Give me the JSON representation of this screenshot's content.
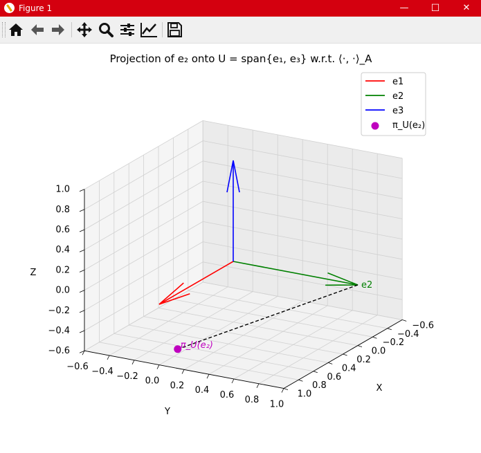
{
  "window": {
    "title": "Figure 1",
    "minimize": "—",
    "maximize": "☐",
    "close": "✕"
  },
  "toolbar": {
    "buttons": [
      "home-icon",
      "back-icon",
      "forward-icon",
      "pan-icon",
      "zoom-icon",
      "configure-subplots-icon",
      "edit-axis-icon",
      "save-icon"
    ]
  },
  "chart_data": {
    "type": "3d-line",
    "title": "Projection of e₂ onto U = span{e₁, e₃} w.r.t. ⟨·, ·⟩_A",
    "xlabel": "X",
    "ylabel": "Y",
    "zlabel": "Z",
    "xlim": [
      -0.6,
      1.0
    ],
    "ylim": [
      -0.6,
      1.0
    ],
    "zlim": [
      -0.6,
      1.0
    ],
    "xticks": [
      "−0.6",
      "−0.4",
      "−0.2",
      "0.0",
      "0.2",
      "0.4",
      "0.6",
      "0.8",
      "1.0"
    ],
    "yticks": [
      "−0.6",
      "−0.4",
      "−0.2",
      "0.0",
      "0.2",
      "0.4",
      "0.6",
      "0.8",
      "1.0"
    ],
    "zticks": [
      "−0.6",
      "−0.4",
      "−0.2",
      "0.0",
      "0.2",
      "0.4",
      "0.6",
      "0.8",
      "1.0"
    ],
    "grid": true,
    "legend_position": "upper-right",
    "series": [
      {
        "name": "e1",
        "color": "#ff0000",
        "from": [
          0,
          0,
          0
        ],
        "to": [
          1,
          0,
          0
        ],
        "arrow": true
      },
      {
        "name": "e2",
        "color": "#008000",
        "from": [
          0,
          0,
          0
        ],
        "to": [
          0,
          1,
          0
        ],
        "arrow": true,
        "label": "e2"
      },
      {
        "name": "e3",
        "color": "#0000ff",
        "from": [
          0,
          0,
          0
        ],
        "to": [
          0,
          0,
          1
        ],
        "arrow": true
      }
    ],
    "projection_point": {
      "name": "π_U(e₂)",
      "color": "#bf00bf",
      "position": [
        0.75,
        0,
        -0.55
      ],
      "label": "π_U(e₂)"
    },
    "projection_line": {
      "from": [
        0,
        1,
        0
      ],
      "to": [
        0.75,
        0,
        -0.55
      ],
      "style": "dashed",
      "color": "#000000"
    }
  }
}
